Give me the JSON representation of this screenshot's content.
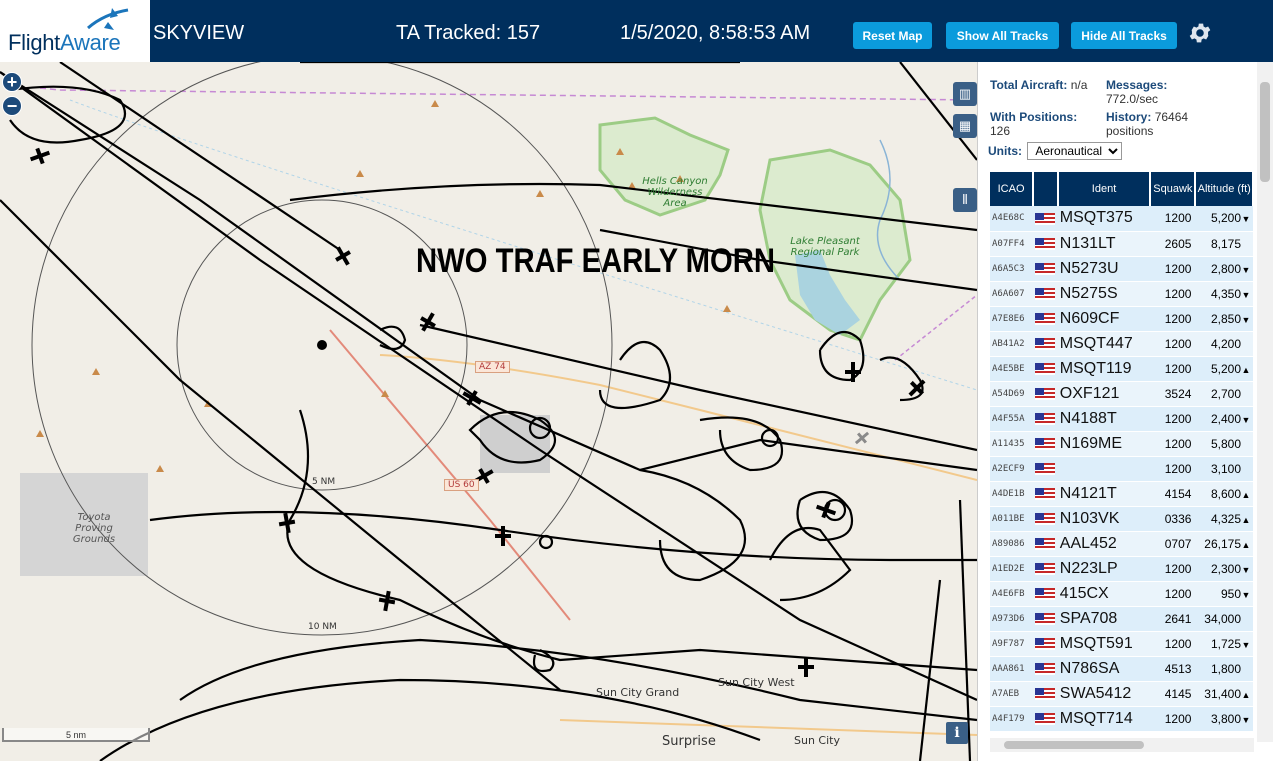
{
  "header": {
    "logo_flight": "Flight",
    "logo_aware": "Aware",
    "title": "SKYVIEW",
    "tracked": "TA Tracked: 157",
    "datetime": "1/5/2020, 8:58:53 AM",
    "reset_map": "Reset Map",
    "show_all_tracks": "Show All Tracks",
    "hide_all_tracks": "Hide All Tracks",
    "settings_icon": "gear-icon"
  },
  "map": {
    "zoom_in": "+",
    "zoom_out": "−",
    "banner": "NWO TRAF EARLY MORN",
    "labels": {
      "hells_canyon": "Hells Canyon Wilderness Area",
      "lake_pleasant": "Lake Pleasant Regional Park",
      "toyota": "Toyota Proving Grounds",
      "range_5": "5 NM",
      "range_10": "10 NM",
      "sun_city_grand": "Sun City Grand",
      "sun_city_west": "Sun City West",
      "surprise": "Surprise",
      "sun_city": "Sun City"
    },
    "shields": {
      "az74": "AZ 74",
      "us60": "US 60"
    },
    "scale": "5 nm",
    "info": "i",
    "controls": [
      "map-layers-icon",
      "grid-icon",
      "columns-icon"
    ],
    "colors": {
      "land": "#f1eee7",
      "track": "#000000",
      "water": "#aad3df",
      "park": "#c8dfb5"
    }
  },
  "panel": {
    "total_aircraft_label": "Total Aircraft:",
    "total_aircraft_value": "n/a",
    "messages_label": "Messages:",
    "messages_value": "772.0/sec",
    "with_positions_label": "With Positions:",
    "with_positions_value": "126",
    "history_label": "History:",
    "history_value": "76464 positions",
    "units_label": "Units:",
    "units_value": "Aeronautical",
    "columns": [
      "ICAO",
      "",
      "Ident",
      "Squawk",
      "Altitude (ft)"
    ],
    "rows": [
      {
        "icao": "A4E68C",
        "ident": "MSQT375",
        "squawk": "1200",
        "alt": "5,200",
        "trend": "▼"
      },
      {
        "icao": "A07FF4",
        "ident": "N131LT",
        "squawk": "2605",
        "alt": "8,175",
        "trend": ""
      },
      {
        "icao": "A6A5C3",
        "ident": "N5273U",
        "squawk": "1200",
        "alt": "2,800",
        "trend": "▼"
      },
      {
        "icao": "A6A607",
        "ident": "N5275S",
        "squawk": "1200",
        "alt": "4,350",
        "trend": "▼"
      },
      {
        "icao": "A7E8E6",
        "ident": "N609CF",
        "squawk": "1200",
        "alt": "2,850",
        "trend": "▼"
      },
      {
        "icao": "AB41A2",
        "ident": "MSQT447",
        "squawk": "1200",
        "alt": "4,200",
        "trend": ""
      },
      {
        "icao": "A4E5BE",
        "ident": "MSQT119",
        "squawk": "1200",
        "alt": "5,200",
        "trend": "▲"
      },
      {
        "icao": "A54D69",
        "ident": "OXF121",
        "squawk": "3524",
        "alt": "2,700",
        "trend": ""
      },
      {
        "icao": "A4F55A",
        "ident": "N4188T",
        "squawk": "1200",
        "alt": "2,400",
        "trend": "▼"
      },
      {
        "icao": "A11435",
        "ident": "N169ME",
        "squawk": "1200",
        "alt": "5,800",
        "trend": ""
      },
      {
        "icao": "A2ECF9",
        "ident": "",
        "squawk": "1200",
        "alt": "3,100",
        "trend": ""
      },
      {
        "icao": "A4DE1B",
        "ident": "N4121T",
        "squawk": "4154",
        "alt": "8,600",
        "trend": "▲"
      },
      {
        "icao": "A011BE",
        "ident": "N103VK",
        "squawk": "0336",
        "alt": "4,325",
        "trend": "▲"
      },
      {
        "icao": "A89086",
        "ident": "AAL452",
        "squawk": "0707",
        "alt": "26,175",
        "trend": "▲"
      },
      {
        "icao": "A1ED2E",
        "ident": "N223LP",
        "squawk": "1200",
        "alt": "2,300",
        "trend": "▼"
      },
      {
        "icao": "A4E6FB",
        "ident": "415CX",
        "squawk": "1200",
        "alt": "950",
        "trend": "▼"
      },
      {
        "icao": "A973D6",
        "ident": "SPA708",
        "squawk": "2641",
        "alt": "34,000",
        "trend": ""
      },
      {
        "icao": "A9F787",
        "ident": "MSQT591",
        "squawk": "1200",
        "alt": "1,725",
        "trend": "▼"
      },
      {
        "icao": "AAA861",
        "ident": "N786SA",
        "squawk": "4513",
        "alt": "1,800",
        "trend": ""
      },
      {
        "icao": "A7AEB",
        "ident": "SWA5412",
        "squawk": "4145",
        "alt": "31,400",
        "trend": "▲"
      },
      {
        "icao": "A4F179",
        "ident": "MSQT714",
        "squawk": "1200",
        "alt": "3,800",
        "trend": "▼"
      }
    ]
  }
}
